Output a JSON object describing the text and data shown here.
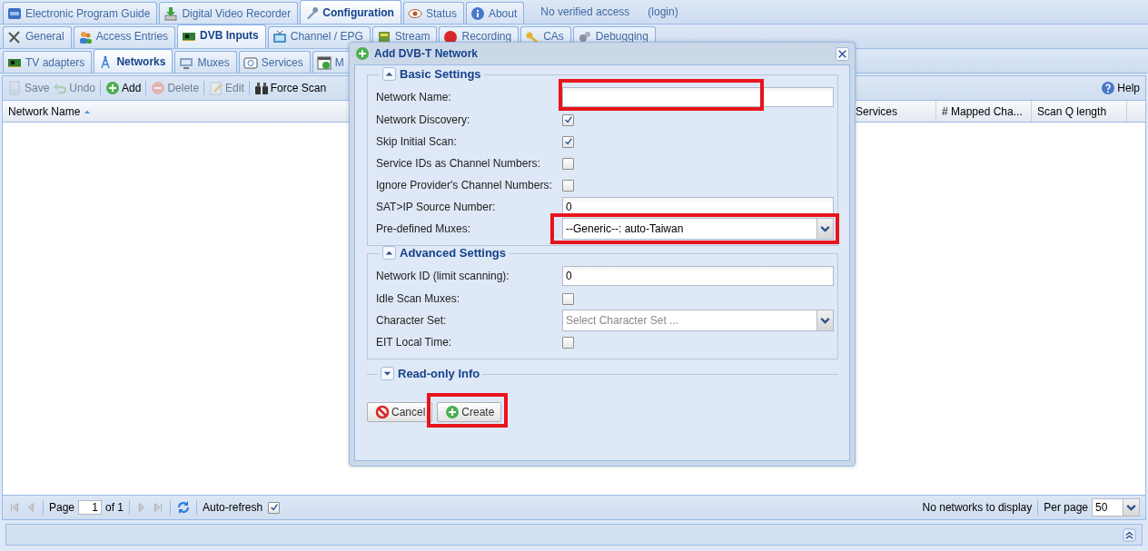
{
  "main_tabs": [
    {
      "label": "Electronic Program Guide",
      "selected": false
    },
    {
      "label": "Digital Video Recorder",
      "selected": false
    },
    {
      "label": "Configuration",
      "selected": true
    },
    {
      "label": "Status",
      "selected": false
    },
    {
      "label": "About",
      "selected": false
    }
  ],
  "access_status": "No verified access",
  "login_link": "(login)",
  "config_tabs": [
    {
      "label": "General",
      "selected": false
    },
    {
      "label": "Access Entries",
      "selected": false
    },
    {
      "label": "DVB Inputs",
      "selected": true
    },
    {
      "label": "Channel / EPG",
      "selected": false
    },
    {
      "label": "Stream",
      "selected": false
    },
    {
      "label": "Recording",
      "selected": false
    },
    {
      "label": "CAs",
      "selected": false
    },
    {
      "label": "Debugging",
      "selected": false
    }
  ],
  "dvb_tabs": [
    {
      "label": "TV adapters",
      "selected": false
    },
    {
      "label": "Networks",
      "selected": true
    },
    {
      "label": "Muxes",
      "selected": false
    },
    {
      "label": "Services",
      "selected": false
    },
    {
      "label": "M",
      "selected": false
    }
  ],
  "toolbar": {
    "buttons": [
      {
        "label": "Save",
        "disabled": true
      },
      {
        "label": "Undo",
        "disabled": true
      },
      {
        "label": "Add",
        "disabled": false
      },
      {
        "label": "Delete",
        "disabled": true
      },
      {
        "label": "Edit",
        "disabled": true
      },
      {
        "label": "Force Scan",
        "disabled": false
      }
    ],
    "help": "Help"
  },
  "grid": {
    "columns": [
      {
        "label": "Network Name",
        "sorted": true
      },
      {
        "label": "Services",
        "sorted": false
      },
      {
        "label": "# Mapped Cha...",
        "sorted": false
      },
      {
        "label": "Scan Q length",
        "sorted": false
      }
    ]
  },
  "paging": {
    "page_label": "Page",
    "page": "1",
    "of": "of 1",
    "auto_refresh": {
      "label": "Auto-refresh",
      "checked": true
    },
    "status": "No networks to display",
    "per_page_label": "Per page",
    "per_page": "50"
  },
  "dialog": {
    "title": "Add DVB-T Network",
    "sections": [
      {
        "title": "Basic Settings",
        "expanded": true,
        "fields": [
          {
            "kind": "text",
            "label": "Network Name:",
            "highlighted": true
          },
          {
            "kind": "checkbox",
            "label": "Network Discovery:",
            "checked": true
          },
          {
            "kind": "checkbox",
            "label": "Skip Initial Scan:",
            "checked": true
          },
          {
            "kind": "checkbox",
            "label": "Service IDs as Channel Numbers:",
            "checked": false
          },
          {
            "kind": "checkbox",
            "label": "Ignore Provider's Channel Numbers:",
            "checked": false
          },
          {
            "kind": "text",
            "label": "SAT>IP Source Number:",
            "value": "0",
            "highlighted": false
          },
          {
            "kind": "select",
            "label": "Pre-defined Muxes:",
            "value": "--Generic--: auto-Taiwan",
            "highlighted": true
          }
        ]
      },
      {
        "title": "Advanced Settings",
        "expanded": true,
        "fields": [
          {
            "kind": "text",
            "label": "Network ID (limit scanning):",
            "value": "0",
            "highlighted": false
          },
          {
            "kind": "checkbox",
            "label": "Idle Scan Muxes:",
            "checked": false
          },
          {
            "kind": "select",
            "label": "Character Set:",
            "placeholder": "Select Character Set ...",
            "highlighted": false
          },
          {
            "kind": "checkbox",
            "label": "EIT Local Time:",
            "checked": false
          }
        ]
      },
      {
        "title": "Read-only Info",
        "expanded": false
      }
    ],
    "buttons": [
      {
        "label": "Cancel",
        "highlighted": false
      },
      {
        "label": "Create",
        "highlighted": true
      }
    ]
  }
}
